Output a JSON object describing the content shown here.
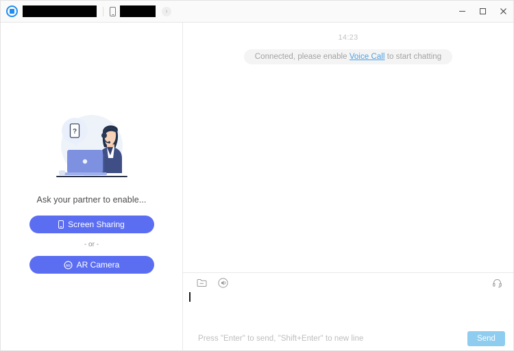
{
  "titlebar": {
    "logo_icon": "app-logo-icon",
    "title_redacted": "",
    "device_icon": "phone-icon",
    "device_redacted": "",
    "chevron_label": "›",
    "minimize_label": "minimize-icon",
    "maximize_label": "maximize-icon",
    "close_label": "close-icon"
  },
  "sidebar": {
    "illustration": "support-agent-illustration",
    "illustration_bubble_text": "?",
    "prompt": "Ask your partner to enable...",
    "screen_sharing_label": "Screen Sharing",
    "or_label": "- or -",
    "ar_camera_label": "AR Camera",
    "ar_badge_text": "AR"
  },
  "chat": {
    "timestamp": "14:23",
    "system_message_prefix": "Connected, please enable ",
    "system_message_link": "Voice Call",
    "system_message_suffix": " to start chatting"
  },
  "composer": {
    "file_icon": "folder-icon",
    "sound_icon": "sound-icon",
    "headset_icon": "headset-icon",
    "message_value": "",
    "hint": "Press \"Enter\" to send, \"Shift+Enter\" to new line",
    "send_label": "Send"
  },
  "colors": {
    "accent_blue": "#5b6ef2",
    "link_blue": "#4f9fe0",
    "send_blue": "#8ecdef",
    "logo_blue": "#1f8ef1",
    "panel_bg": "#ffffff",
    "titlebar_bg": "#fafafa",
    "pill_bg": "#f4f4f4"
  }
}
